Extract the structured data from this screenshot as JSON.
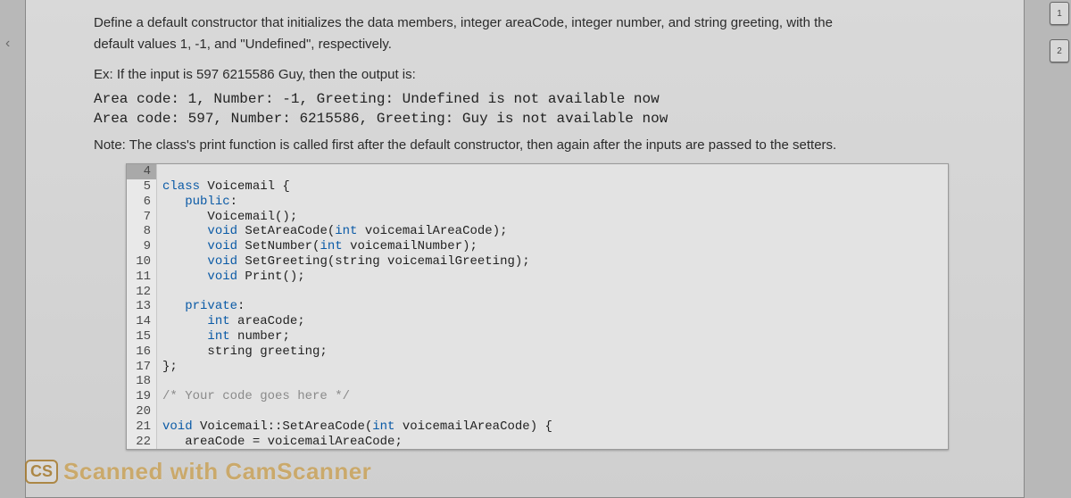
{
  "intro": {
    "line1": "Define a default constructor that initializes the data members, integer areaCode, integer number, and string greeting, with the",
    "line2": "default values 1, -1, and \"Undefined\", respectively."
  },
  "example": {
    "lead": "Ex: If the input is 597  6215586  Guy, then the output is:",
    "out1": "Area code: 1, Number: -1, Greeting: Undefined is not available now",
    "out2": "Area code: 597, Number: 6215586, Greeting: Guy is not available now"
  },
  "note": "Note: The class's print function is called first after the default constructor, then again after the inputs are passed to the setters.",
  "code": {
    "lines": [
      {
        "n": "4",
        "dark": true,
        "t": ""
      },
      {
        "n": "5",
        "t": "class Voicemail {",
        "kw": [
          "class"
        ]
      },
      {
        "n": "6",
        "t": "   public:",
        "kw": [
          "public"
        ]
      },
      {
        "n": "7",
        "t": "      Voicemail();"
      },
      {
        "n": "8",
        "t": "      void SetAreaCode(int voicemailAreaCode);",
        "kw": [
          "void",
          "int"
        ]
      },
      {
        "n": "9",
        "t": "      void SetNumber(int voicemailNumber);",
        "kw": [
          "void",
          "int"
        ]
      },
      {
        "n": "10",
        "t": "      void SetGreeting(string voicemailGreeting);",
        "kw": [
          "void"
        ]
      },
      {
        "n": "11",
        "t": "      void Print();",
        "kw": [
          "void"
        ]
      },
      {
        "n": "12",
        "t": ""
      },
      {
        "n": "13",
        "t": "   private:",
        "kw": [
          "private"
        ]
      },
      {
        "n": "14",
        "t": "      int areaCode;",
        "kw": [
          "int"
        ]
      },
      {
        "n": "15",
        "t": "      int number;",
        "kw": [
          "int"
        ]
      },
      {
        "n": "16",
        "t": "      string greeting;"
      },
      {
        "n": "17",
        "t": "};"
      },
      {
        "n": "18",
        "t": ""
      },
      {
        "n": "19",
        "t": "/* Your code goes here */",
        "comment": true
      },
      {
        "n": "20",
        "t": ""
      },
      {
        "n": "21",
        "t": "void Voicemail::SetAreaCode(int voicemailAreaCode) {",
        "kw": [
          "void",
          "int"
        ]
      },
      {
        "n": "22",
        "t": "   areaCode = voicemailAreaCode;"
      }
    ]
  },
  "watermark": {
    "badge": "CS",
    "text": "Scanned with CamScanner"
  },
  "side": {
    "a": "1",
    "b": "2"
  },
  "arrow": "‹"
}
